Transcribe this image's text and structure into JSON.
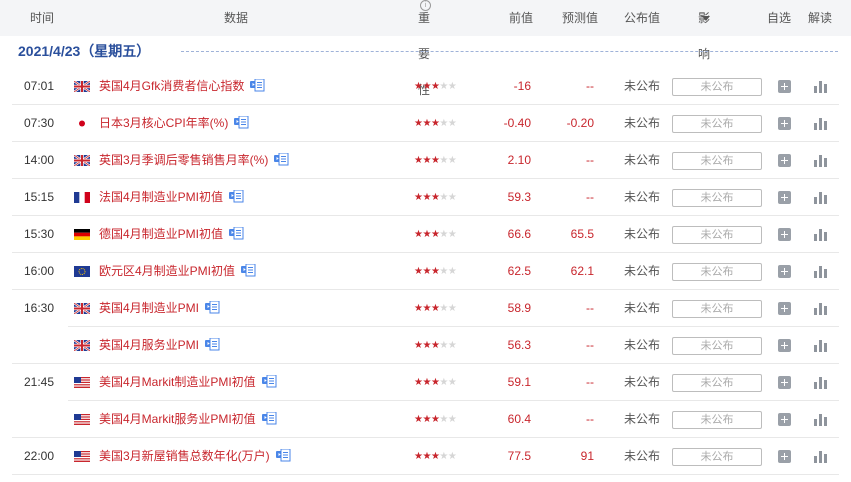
{
  "header": {
    "time": "时间",
    "data": "数据",
    "importance": "重要性",
    "importance_help_icon": "i",
    "previous": "前值",
    "forecast": "预测值",
    "actual": "公布值",
    "influence": "影响",
    "favorite": "自选",
    "interpret": "解读"
  },
  "date_label": "2021/4/23（星期五）",
  "importance_scale": 5,
  "influence_placeholder": "未公布",
  "rows": [
    {
      "time": "07:01",
      "flag": "gb",
      "name": "英国4月Gfk消费者信心指数",
      "stars": 3,
      "prev": "-16",
      "forecast": "--",
      "actual": "未公布"
    },
    {
      "time": "07:30",
      "flag": "jp",
      "name": "日本3月核心CPI年率(%)",
      "stars": 3,
      "prev": "-0.40",
      "forecast": "-0.20",
      "actual": "未公布"
    },
    {
      "time": "14:00",
      "flag": "gb",
      "name": "英国3月季调后零售销售月率(%)",
      "stars": 3,
      "prev": "2.10",
      "forecast": "--",
      "actual": "未公布"
    },
    {
      "time": "15:15",
      "flag": "fr",
      "name": "法国4月制造业PMI初值",
      "stars": 3,
      "prev": "59.3",
      "forecast": "--",
      "actual": "未公布"
    },
    {
      "time": "15:30",
      "flag": "de",
      "name": "德国4月制造业PMI初值",
      "stars": 3,
      "prev": "66.6",
      "forecast": "65.5",
      "actual": "未公布"
    },
    {
      "time": "16:00",
      "flag": "eu",
      "name": "欧元区4月制造业PMI初值",
      "stars": 3,
      "prev": "62.5",
      "forecast": "62.1",
      "actual": "未公布"
    },
    {
      "time": "16:30",
      "flag": "gb",
      "name": "英国4月制造业PMI",
      "stars": 3,
      "prev": "58.9",
      "forecast": "--",
      "actual": "未公布"
    },
    {
      "time": "",
      "flag": "gb",
      "name": "英国4月服务业PMI",
      "stars": 3,
      "prev": "56.3",
      "forecast": "--",
      "actual": "未公布"
    },
    {
      "time": "21:45",
      "flag": "us",
      "name": "美国4月Markit制造业PMI初值",
      "stars": 3,
      "prev": "59.1",
      "forecast": "--",
      "actual": "未公布"
    },
    {
      "time": "",
      "flag": "us",
      "name": "美国4月Markit服务业PMI初值",
      "stars": 3,
      "prev": "60.4",
      "forecast": "--",
      "actual": "未公布"
    },
    {
      "time": "22:00",
      "flag": "us",
      "name": "美国3月新屋销售总数年化(万户)",
      "stars": 3,
      "prev": "77.5",
      "forecast": "91",
      "actual": "未公布"
    }
  ],
  "colors": {
    "accent": "#c8262d",
    "date": "#2a4f9c",
    "doc_icon": "#4a86e8"
  }
}
